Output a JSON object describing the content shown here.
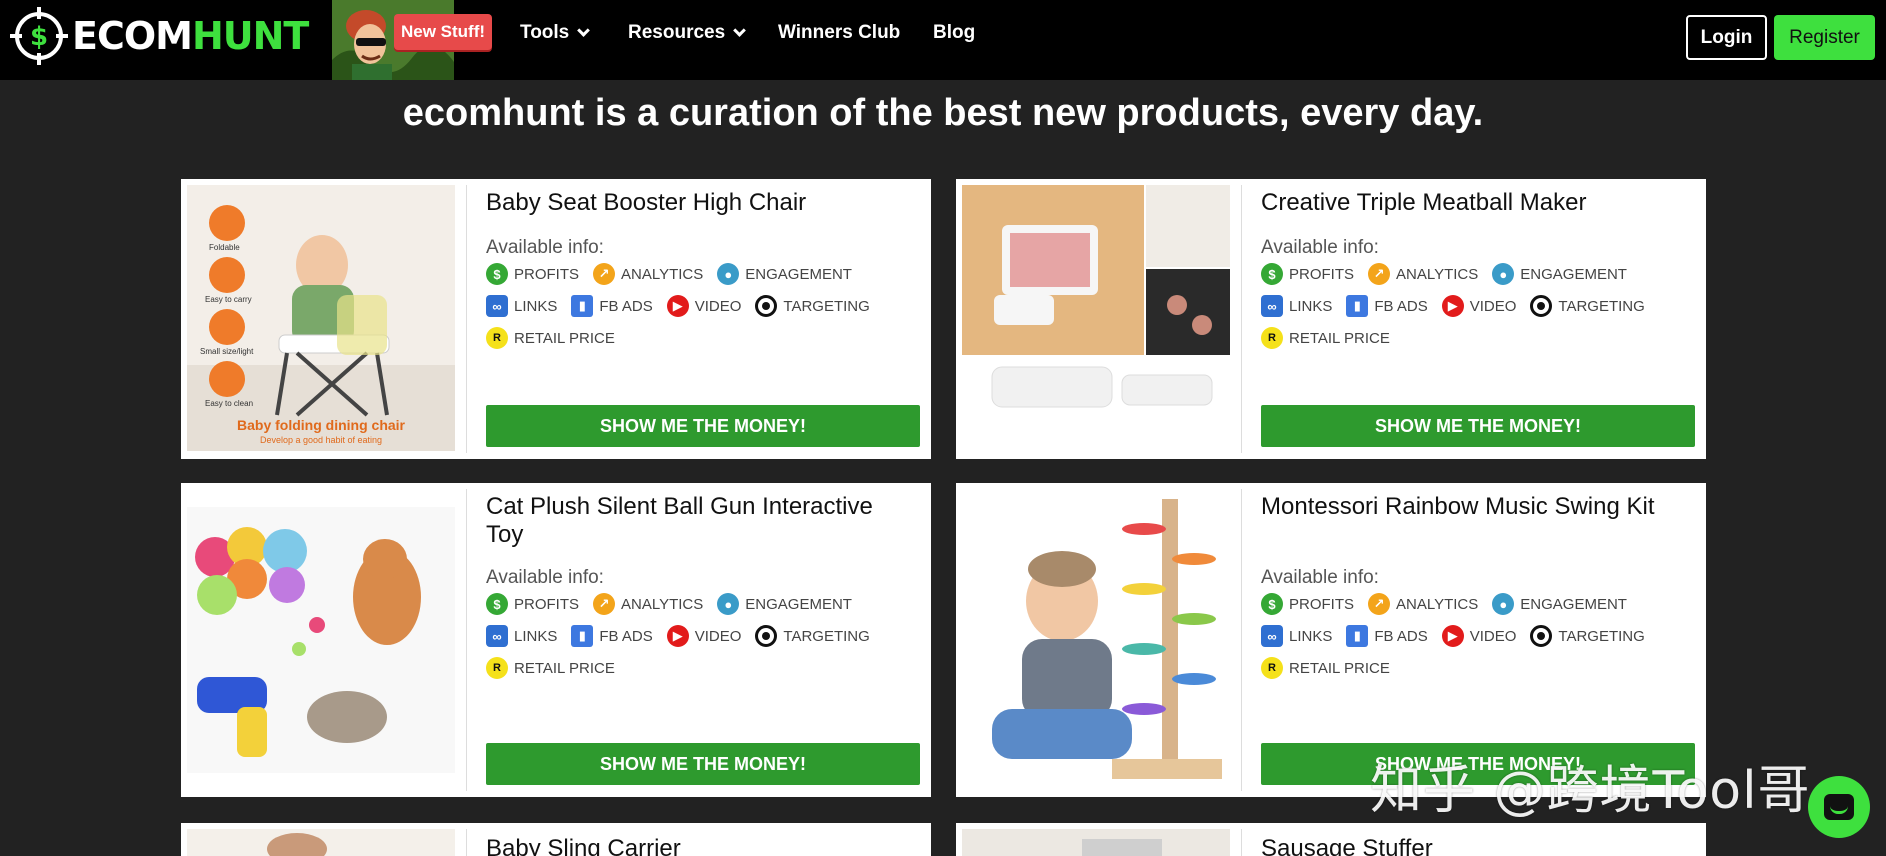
{
  "nav": {
    "logo_eco": "ECOM",
    "logo_hunt": "HUNT",
    "new_badge": "New Stuff!",
    "items": [
      {
        "label": "Tools"
      },
      {
        "label": "Resources"
      },
      {
        "label": "Winners Club"
      },
      {
        "label": "Blog"
      }
    ],
    "login": "Login",
    "register": "Register"
  },
  "hero": "ecomhunt is a curation of the best new products, every day.",
  "available_label": "Available info:",
  "info_labels": {
    "profits": "PROFITS",
    "analytics": "ANALYTICS",
    "engagement": "ENGAGEMENT",
    "links": "LINKS",
    "fbads": "FB ADS",
    "video": "VIDEO",
    "targeting": "TARGETING",
    "retail": "RETAIL PRICE"
  },
  "icon_glyphs": {
    "profits": "$",
    "retail": "R"
  },
  "cta": "SHOW ME THE MONEY!",
  "products": [
    {
      "title": "Baby Seat Booster High Chair",
      "image_icons": [
        "Foldable",
        "Easy to carry",
        "Small size/light",
        "Easy to clean"
      ],
      "image_caption": "Baby folding dining chair",
      "image_subcaption": "Develop a good habit of eating"
    },
    {
      "title": "Creative Triple Meatball Maker"
    },
    {
      "title": "Cat Plush Silent Ball Gun Interactive Toy"
    },
    {
      "title": "Montessori Rainbow Music Swing Kit"
    },
    {
      "title": "Baby Sling Carrier"
    },
    {
      "title": "Sausage Stuffer"
    }
  ],
  "watermark": "知乎 @跨境Tool哥",
  "colors": {
    "accent": "#3ee03e",
    "cta": "#2e9a2e",
    "badge": "#e74a4a",
    "bg": "#222222"
  }
}
